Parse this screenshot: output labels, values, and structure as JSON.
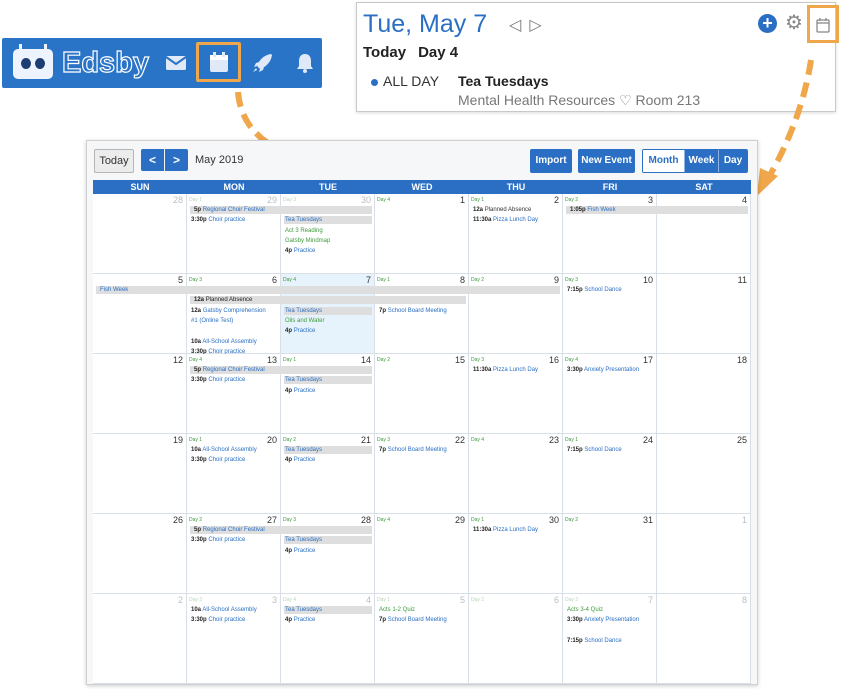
{
  "navbar": {
    "brand": "Edsby",
    "icons": [
      "mail-icon",
      "calendar-icon",
      "rocket-icon",
      "bell-icon"
    ]
  },
  "day_panel": {
    "date": "Tue, May 7",
    "today_label": "Today",
    "day_label": "Day 4",
    "event": {
      "time": "ALL DAY",
      "title": "Tea Tuesdays",
      "location": "Mental Health Resources ♡ Room 213"
    }
  },
  "toolbar": {
    "today": "Today",
    "prev": "<",
    "next": ">",
    "month_label": "May 2019",
    "import": "Import",
    "new_event": "New Event",
    "view_month": "Month",
    "view_week": "Week",
    "view_day": "Day"
  },
  "weekdays": [
    "SUN",
    "MON",
    "TUE",
    "WED",
    "THU",
    "FRI",
    "SAT"
  ],
  "colors": {
    "accent": "#2a6fc4",
    "highlight": "#f0a64a",
    "green": "#3d9a3d",
    "today_bg": "#e7f3fc"
  },
  "weeks": [
    {
      "days": [
        {
          "num": "28",
          "cday": "",
          "out": true
        },
        {
          "num": "29",
          "cday": "Day 1",
          "out": true
        },
        {
          "num": "30",
          "cday": "Day 3",
          "out": true
        },
        {
          "num": "1",
          "cday": "Day 4"
        },
        {
          "num": "2",
          "cday": "Day 1"
        },
        {
          "num": "3",
          "cday": "Day 2"
        },
        {
          "num": "4",
          "cday": ""
        }
      ],
      "bars": [
        {
          "col": 1,
          "span": 2,
          "row": 0,
          "time": "5p",
          "text": "Regional Choir Festival"
        },
        {
          "col": 5,
          "span": 2,
          "row": 0,
          "time": "1:05p",
          "text": "Fish Week"
        }
      ],
      "events": [
        {
          "col": 1,
          "row": 1,
          "time": "3:30p",
          "text": "Choir practice",
          "color": "blue"
        },
        {
          "col": 2,
          "row": 1,
          "time": "",
          "text": "Tea Tuesdays",
          "color": "blue",
          "bg": true
        },
        {
          "col": 2,
          "row": 2,
          "time": "",
          "text": "Act 3 Reading",
          "color": "green"
        },
        {
          "col": 2,
          "row": 3,
          "time": "",
          "text": "Gatsby Mindmap",
          "color": "green"
        },
        {
          "col": 2,
          "row": 4,
          "time": "4p",
          "text": "Practice",
          "color": "blue"
        },
        {
          "col": 4,
          "row": 0,
          "time": "12a",
          "text": "Planned Absence",
          "color": "dark"
        },
        {
          "col": 4,
          "row": 1,
          "time": "11:30a",
          "text": "Pizza Lunch Day",
          "color": "blue"
        }
      ]
    },
    {
      "days": [
        {
          "num": "5",
          "cday": ""
        },
        {
          "num": "6",
          "cday": "Day 3"
        },
        {
          "num": "7",
          "cday": "Day 4",
          "today": true
        },
        {
          "num": "8",
          "cday": "Day 1"
        },
        {
          "num": "9",
          "cday": "Day 2"
        },
        {
          "num": "10",
          "cday": "Day 3"
        },
        {
          "num": "11",
          "cday": ""
        }
      ],
      "bars": [
        {
          "col": 0,
          "span": 5,
          "row": 0,
          "time": "",
          "text": "Fish Week"
        },
        {
          "col": 1,
          "span": 3,
          "row": 1,
          "time": "12a",
          "text": "Planned Absence",
          "dark": true
        }
      ],
      "events": [
        {
          "col": 1,
          "row": 2,
          "time": "12a",
          "text": "Gatsby Comprehension",
          "color": "blue"
        },
        {
          "col": 1,
          "row": 3,
          "time": "",
          "text": "#1 (Online Test)",
          "color": "blue"
        },
        {
          "col": 1,
          "row": 5,
          "time": "10a",
          "text": "All-School Assembly",
          "color": "blue"
        },
        {
          "col": 1,
          "row": 6,
          "time": "3:30p",
          "text": "Choir practice",
          "color": "blue"
        },
        {
          "col": 2,
          "row": 2,
          "time": "",
          "text": "Tea Tuesdays",
          "color": "blue",
          "bg": true
        },
        {
          "col": 2,
          "row": 3,
          "time": "",
          "text": "Oils and Water",
          "color": "green"
        },
        {
          "col": 2,
          "row": 4,
          "time": "4p",
          "text": "Practice",
          "color": "blue"
        },
        {
          "col": 3,
          "row": 2,
          "time": "7p",
          "text": "School Board Meeting",
          "color": "blue"
        },
        {
          "col": 5,
          "row": 0,
          "time": "7:15p",
          "text": "School Dance",
          "color": "blue"
        }
      ]
    },
    {
      "days": [
        {
          "num": "12",
          "cday": ""
        },
        {
          "num": "13",
          "cday": "Day 4"
        },
        {
          "num": "14",
          "cday": "Day 1"
        },
        {
          "num": "15",
          "cday": "Day 2"
        },
        {
          "num": "16",
          "cday": "Day 3"
        },
        {
          "num": "17",
          "cday": "Day 4"
        },
        {
          "num": "18",
          "cday": ""
        }
      ],
      "bars": [
        {
          "col": 1,
          "span": 2,
          "row": 0,
          "time": "5p",
          "text": "Regional Choir Festival"
        }
      ],
      "events": [
        {
          "col": 1,
          "row": 1,
          "time": "3:30p",
          "text": "Choir practice",
          "color": "blue"
        },
        {
          "col": 2,
          "row": 1,
          "time": "",
          "text": "Tea Tuesdays",
          "color": "blue",
          "bg": true
        },
        {
          "col": 2,
          "row": 2,
          "time": "4p",
          "text": "Practice",
          "color": "blue"
        },
        {
          "col": 4,
          "row": 0,
          "time": "11:30a",
          "text": "Pizza Lunch Day",
          "color": "blue"
        },
        {
          "col": 5,
          "row": 0,
          "time": "3:30p",
          "text": "Anxiety Presentation",
          "color": "blue"
        }
      ]
    },
    {
      "days": [
        {
          "num": "19",
          "cday": ""
        },
        {
          "num": "20",
          "cday": "Day 1"
        },
        {
          "num": "21",
          "cday": "Day 2"
        },
        {
          "num": "22",
          "cday": "Day 3"
        },
        {
          "num": "23",
          "cday": "Day 4"
        },
        {
          "num": "24",
          "cday": "Day 1"
        },
        {
          "num": "25",
          "cday": ""
        }
      ],
      "bars": [],
      "events": [
        {
          "col": 1,
          "row": 0,
          "time": "10a",
          "text": "All-School Assembly",
          "color": "blue"
        },
        {
          "col": 1,
          "row": 1,
          "time": "3:30p",
          "text": "Choir practice",
          "color": "blue"
        },
        {
          "col": 2,
          "row": 0,
          "time": "",
          "text": "Tea Tuesdays",
          "color": "blue",
          "bg": true
        },
        {
          "col": 2,
          "row": 1,
          "time": "4p",
          "text": "Practice",
          "color": "blue"
        },
        {
          "col": 3,
          "row": 0,
          "time": "7p",
          "text": "School Board Meeting",
          "color": "blue"
        },
        {
          "col": 5,
          "row": 0,
          "time": "7:15p",
          "text": "School Dance",
          "color": "blue"
        }
      ]
    },
    {
      "days": [
        {
          "num": "26",
          "cday": ""
        },
        {
          "num": "27",
          "cday": "Day 2"
        },
        {
          "num": "28",
          "cday": "Day 3"
        },
        {
          "num": "29",
          "cday": "Day 4"
        },
        {
          "num": "30",
          "cday": "Day 1"
        },
        {
          "num": "31",
          "cday": "Day 2"
        },
        {
          "num": "1",
          "cday": "",
          "out": true
        }
      ],
      "bars": [
        {
          "col": 1,
          "span": 2,
          "row": 0,
          "time": "5p",
          "text": "Regional Choir Festival"
        }
      ],
      "events": [
        {
          "col": 1,
          "row": 1,
          "time": "3:30p",
          "text": "Choir practice",
          "color": "blue"
        },
        {
          "col": 2,
          "row": 1,
          "time": "",
          "text": "Tea Tuesdays",
          "color": "blue",
          "bg": true
        },
        {
          "col": 2,
          "row": 2,
          "time": "4p",
          "text": "Practice",
          "color": "blue"
        },
        {
          "col": 4,
          "row": 0,
          "time": "11:30a",
          "text": "Pizza Lunch Day",
          "color": "blue"
        }
      ]
    },
    {
      "days": [
        {
          "num": "2",
          "cday": "",
          "out": true
        },
        {
          "num": "3",
          "cday": "Day 3",
          "out": true
        },
        {
          "num": "4",
          "cday": "Day 4",
          "out": true
        },
        {
          "num": "5",
          "cday": "Day 1",
          "out": true
        },
        {
          "num": "6",
          "cday": "Day 2",
          "out": true
        },
        {
          "num": "7",
          "cday": "Day 3",
          "out": true
        },
        {
          "num": "8",
          "cday": "",
          "out": true
        }
      ],
      "bars": [],
      "events": [
        {
          "col": 1,
          "row": 0,
          "time": "10a",
          "text": "All-School Assembly",
          "color": "blue"
        },
        {
          "col": 1,
          "row": 1,
          "time": "3:30p",
          "text": "Choir practice",
          "color": "blue"
        },
        {
          "col": 2,
          "row": 0,
          "time": "",
          "text": "Tea Tuesdays",
          "color": "blue",
          "bg": true
        },
        {
          "col": 2,
          "row": 1,
          "time": "4p",
          "text": "Practice",
          "color": "blue"
        },
        {
          "col": 3,
          "row": 0,
          "time": "",
          "text": "Acts 1-2 Quiz",
          "color": "green"
        },
        {
          "col": 3,
          "row": 1,
          "time": "7p",
          "text": "School Board Meeting",
          "color": "blue"
        },
        {
          "col": 5,
          "row": 0,
          "time": "",
          "text": "Acts 3-4 Quiz",
          "color": "green"
        },
        {
          "col": 5,
          "row": 1,
          "time": "3:30p",
          "text": "Anxiety Presentation",
          "color": "blue"
        },
        {
          "col": 5,
          "row": 3,
          "time": "7:15p",
          "text": "School Dance",
          "color": "blue"
        }
      ]
    }
  ]
}
